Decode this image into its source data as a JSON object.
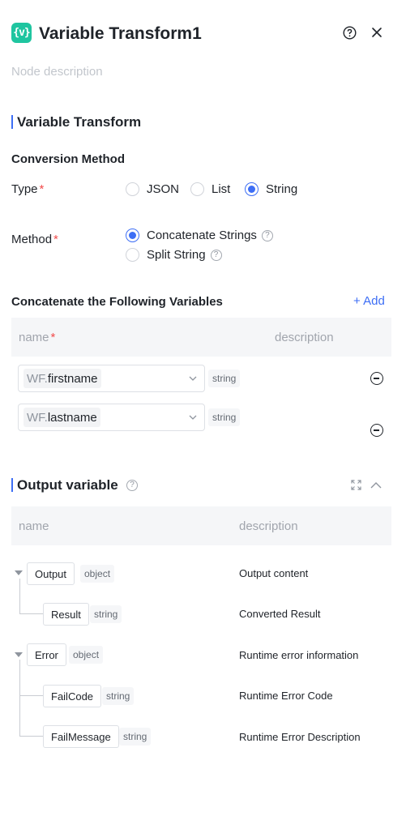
{
  "header": {
    "title": "Variable Transform1",
    "description_placeholder": "Node description",
    "help_icon": "question-circle-icon",
    "close_icon": "close-icon"
  },
  "section_variable_transform": {
    "title": "Variable Transform",
    "conversion_method_title": "Conversion Method",
    "type_label": "Type",
    "type_options": [
      "JSON",
      "List",
      "String"
    ],
    "type_selected": "String",
    "method_label": "Method",
    "method_options": [
      "Concatenate Strings",
      "Split String"
    ],
    "method_selected": "Concatenate Strings",
    "required_mark": "*"
  },
  "concatenate": {
    "title": "Concatenate the Following Variables",
    "add_label": "+ Add",
    "col_name": "name",
    "col_description": "description",
    "rows": [
      {
        "prefix": "WF.",
        "var": "firstname",
        "type": "string"
      },
      {
        "prefix": "WF.",
        "var": "lastname",
        "type": "string"
      }
    ]
  },
  "output": {
    "title": "Output variable",
    "col_name": "name",
    "col_description": "description",
    "nodes": [
      {
        "name": "Output",
        "type": "object",
        "desc": "Output content"
      },
      {
        "name": "Result",
        "type": "string",
        "desc": "Converted Result"
      },
      {
        "name": "Error",
        "type": "object",
        "desc": "Runtime error information"
      },
      {
        "name": "FailCode",
        "type": "string",
        "desc": "Runtime Error Code"
      },
      {
        "name": "FailMessage",
        "type": "string",
        "desc": "Runtime Error Description"
      }
    ]
  },
  "colors": {
    "accent": "#3d6ef5",
    "badge": "#1fc5a0",
    "required": "#f24b4b"
  }
}
